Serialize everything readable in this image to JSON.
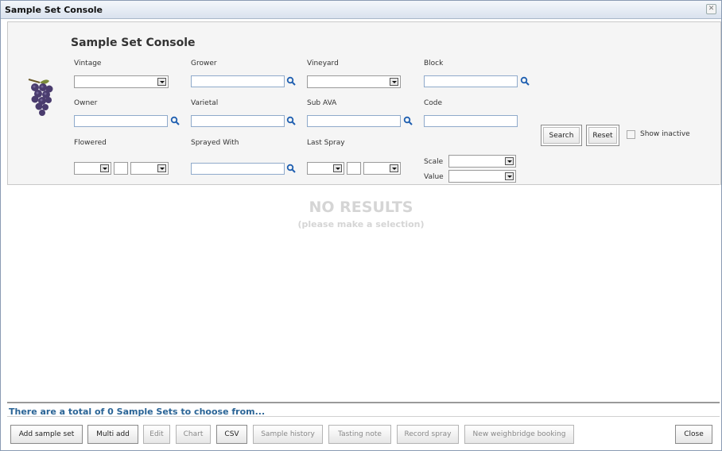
{
  "window": {
    "title": "Sample Set Console"
  },
  "panel": {
    "heading": "Sample Set Console",
    "fields": {
      "vintage": "Vintage",
      "grower": "Grower",
      "vineyard": "Vineyard",
      "block": "Block",
      "owner": "Owner",
      "varietal": "Varietal",
      "sub_ava": "Sub AVA",
      "code": "Code",
      "flowered": "Flowered",
      "sprayed_with": "Sprayed With",
      "last_spray": "Last Spray",
      "scale": "Scale",
      "value": "Value"
    },
    "search_label": "Search",
    "reset_label": "Reset",
    "show_inactive_label": "Show inactive"
  },
  "results": {
    "empty_title": "NO RESULTS",
    "empty_hint": "(please make a selection)"
  },
  "status_text": "There are a total of 0 Sample Sets to choose from...",
  "toolbar": {
    "add_sample_set": "Add sample set",
    "multi_add": "Multi add",
    "edit": "Edit",
    "chart": "Chart",
    "csv": "CSV",
    "sample_history": "Sample history",
    "tasting_note": "Tasting note",
    "record_spray": "Record spray",
    "new_weighbridge_booking": "New weighbridge booking",
    "close": "Close"
  },
  "colors": {
    "status_text": "#2a6496",
    "input_border": "#8faacb",
    "titlebar": "#d9e2ee"
  },
  "icons": {
    "grape": "grape-bunch-icon",
    "search": "magnifier-icon",
    "close": "close-icon"
  }
}
